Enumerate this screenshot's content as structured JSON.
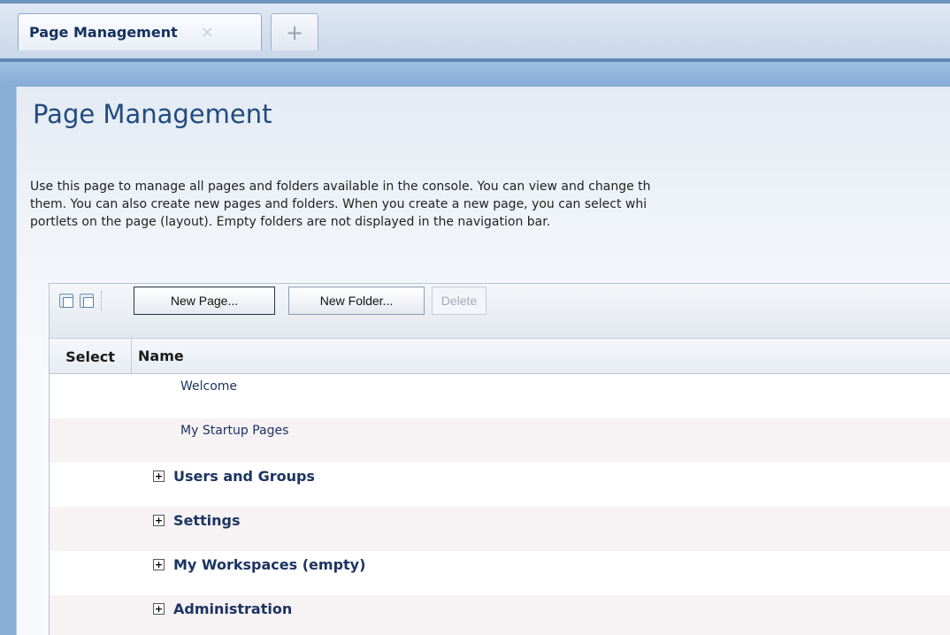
{
  "tabs": {
    "active_label": "Page Management",
    "close_glyph": "×",
    "add_glyph": "+"
  },
  "page": {
    "title": "Page Management",
    "description": "Use this page to manage all pages and folders available in the console. You can view and change th\nthem. You can also create new pages and folders. When you create a new page, you can select whi\nportlets on the page (layout). Empty folders are not displayed in the navigation bar."
  },
  "toolbar": {
    "select_all_icon": "select-all-icon",
    "deselect_all_icon": "deselect-all-icon",
    "new_page_label": "New Page...",
    "new_folder_label": "New Folder...",
    "delete_label": "Delete"
  },
  "table": {
    "columns": [
      "Select",
      "Name"
    ],
    "rows": [
      {
        "name": "Welcome",
        "type": "page"
      },
      {
        "name": "My Startup Pages",
        "type": "page"
      },
      {
        "name": "Users and Groups",
        "type": "folder",
        "expander": "+"
      },
      {
        "name": "Settings",
        "type": "folder",
        "expander": "+"
      },
      {
        "name": "My Workspaces (empty)",
        "type": "folder",
        "expander": "+"
      },
      {
        "name": "Administration",
        "type": "folder",
        "expander": "+"
      }
    ]
  },
  "colors": {
    "title": "#214b80",
    "link": "#1c3461",
    "header_band": "#8ab0d8"
  }
}
